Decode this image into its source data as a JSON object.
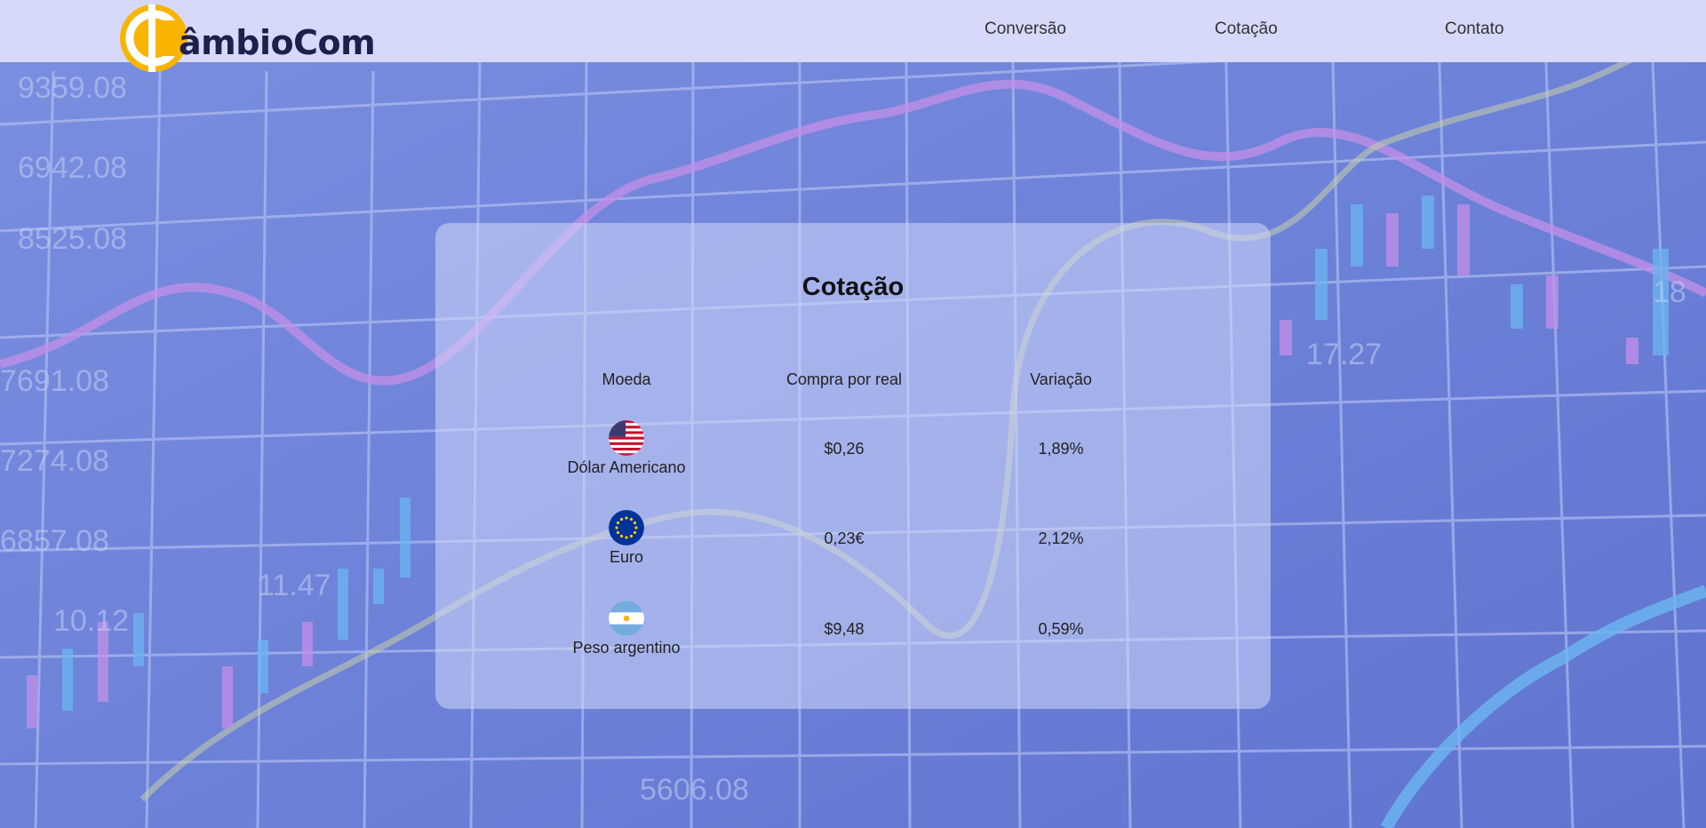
{
  "header": {
    "logo_text": "âmbioCom",
    "nav": {
      "conversao": "Conversão",
      "cotacao": "Cotação",
      "contato": "Contato"
    }
  },
  "card": {
    "title": "Cotação",
    "columns": [
      "Moeda",
      "Compra por real",
      "Variação"
    ],
    "rows": [
      {
        "currency": "Dólar Americano",
        "flag": "usa-flag-icon",
        "buy": "$0,26",
        "variation": "1,89%"
      },
      {
        "currency": "Euro",
        "flag": "eu-flag-icon",
        "buy": "0,23€",
        "variation": "2,12%"
      },
      {
        "currency": "Peso argentino",
        "flag": "argentina-flag-icon",
        "buy": "$9,48",
        "variation": "0,59%"
      }
    ]
  },
  "colors": {
    "header_bg": "#d6d9fa",
    "page_bg": "#6f84d8",
    "logo_coin": "#f8b400",
    "logo_text": "#1d1f4d"
  }
}
